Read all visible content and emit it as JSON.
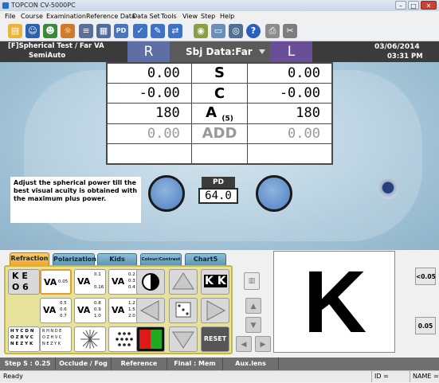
{
  "window": {
    "title": "TOPCON CV-5000PC"
  },
  "menu": [
    "File",
    "Course",
    "Examination",
    "Reference Data",
    "Data Set",
    "Tools",
    "View",
    "Step",
    "Help"
  ],
  "header": {
    "test_name": "[F]Spherical Test / Far VA",
    "mode": "SemiAuto",
    "right_label": "R",
    "sbj_data": "Sbj Data:Far",
    "left_label": "L",
    "date": "03/06/2014",
    "time": "03:31 PM"
  },
  "values": {
    "rows": [
      {
        "right": "0.00",
        "label": "S",
        "left": "0.00"
      },
      {
        "right": "-0.00",
        "label": "C",
        "left": "-0.00"
      },
      {
        "right": "180",
        "label": "A",
        "sub": "(5)",
        "left": "180"
      },
      {
        "right": "0.00",
        "label": "ADD",
        "left": "0.00"
      }
    ]
  },
  "message": "Adjust the spherical power till the best visual acuity is obtained with the maximum plus power.",
  "pd": {
    "label": "PD",
    "value": "64.0"
  },
  "tabs": [
    "Refraction",
    "Polarization",
    "Kids",
    "Colour/Contrast",
    "Chart5"
  ],
  "chart_cells": {
    "ke": [
      "K E",
      "O 6"
    ],
    "va_single": {
      "va": "VA",
      "n": "0.05"
    },
    "va_r1c3": {
      "va": "VA",
      "n": [
        "0.1",
        "",
        "0.16"
      ]
    },
    "va_r1c4": {
      "va": "VA",
      "n": [
        "0.2",
        "0.3",
        "0.4"
      ]
    },
    "va_r2c2": {
      "va": "VA",
      "n": [
        "0.5",
        "0.6",
        "0.7"
      ]
    },
    "va_r2c3": {
      "va": "VA",
      "n": [
        "0.8",
        "0.9",
        "1.0"
      ]
    },
    "va_r2c4": {
      "va": "VA",
      "n": [
        "1.2",
        "1.5",
        "2.0"
      ]
    },
    "letters_r3c1": [
      "H Y C D N",
      "O Z R V C",
      "N E Z Y K"
    ],
    "letters_r3c2": [
      "R H N D E",
      "O Z H V C",
      "N E Z Y K"
    ],
    "reset": "RESET",
    "kk": "K K"
  },
  "k_letter": "K",
  "right_buttons": [
    "<0.05",
    "0.05"
  ],
  "bottom_bar": [
    "Step S : 0.25",
    "Occlude / Fog",
    "Reference Data",
    "Final : Mem",
    "Aux.lens"
  ],
  "status": {
    "left": "Ready",
    "id": "ID =",
    "name": "NAME ="
  }
}
